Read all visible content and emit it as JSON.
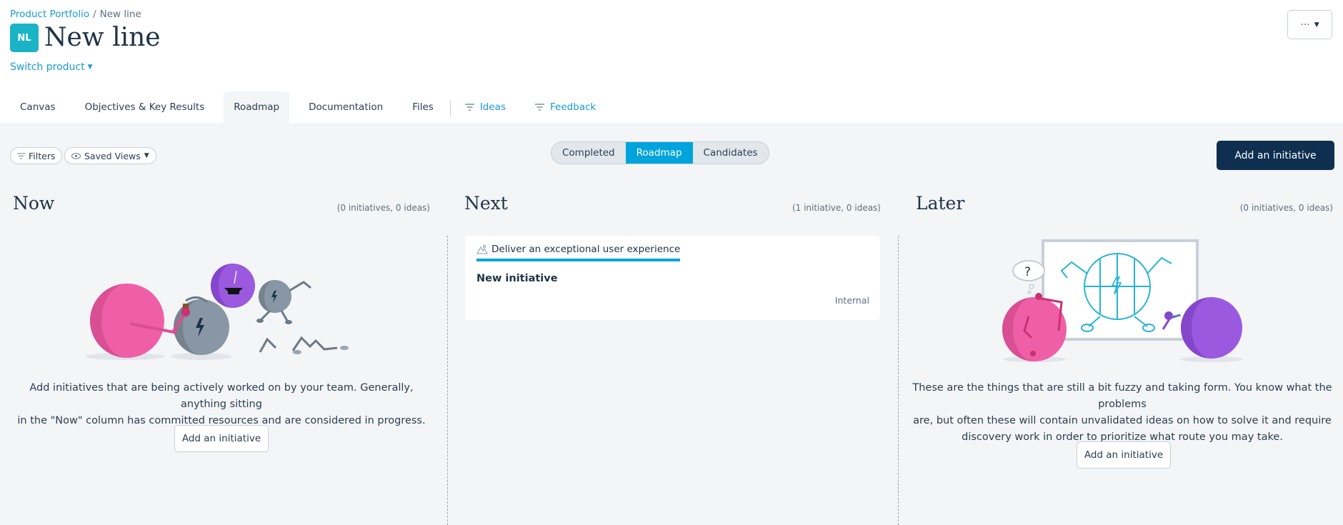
{
  "breadcrumb": {
    "parent": "Product Portfolio",
    "separator": "/",
    "current": "New line"
  },
  "product": {
    "initials": "NL",
    "title": "New line",
    "switch_label": "Switch product",
    "avatar_color": "#1ab4c6"
  },
  "more_menu": {
    "dots": "···"
  },
  "tabs": [
    {
      "label": "Canvas"
    },
    {
      "label": "Objectives & Key Results"
    },
    {
      "label": "Roadmap"
    },
    {
      "label": "Documentation"
    },
    {
      "label": "Files"
    },
    {
      "label": "Ideas"
    },
    {
      "label": "Feedback"
    }
  ],
  "toolbar": {
    "filters_label": "Filters",
    "saved_views_label": "Saved Views",
    "segments": [
      "Completed",
      "Roadmap",
      "Candidates"
    ],
    "active_segment": "Roadmap",
    "add_initiative_label": "Add an initiative"
  },
  "columns": {
    "now": {
      "title": "Now",
      "count": "(0 initiatives, 0 ideas)",
      "description_line1": "Add initiatives that are being actively worked on by your team. Generally, anything sitting",
      "description_line2": "in the \"Now\" column has committed resources and are considered in progress.",
      "button": "Add an initiative"
    },
    "next": {
      "title": "Next",
      "count": "(1 initiative, 0 ideas)",
      "card": {
        "goal": "Deliver an exceptional user experience",
        "title": "New initiative",
        "tag": "Internal"
      }
    },
    "later": {
      "title": "Later",
      "count": "(0 initiatives, 0 ideas)",
      "description_line1": "These are the things that are still a bit fuzzy and taking form. You know what the problems",
      "description_line2": "are, but often these will contain unvalidated ideas on how to solve it and require",
      "description_line3": "discovery work in order to prioritize what route you may take.",
      "button": "Add an initiative"
    }
  },
  "colors": {
    "accent": "#00a4dc",
    "link": "#1b9ad6",
    "primary": "#0e2f4f",
    "pink": "#ef5fa8",
    "purple": "#9b59e0",
    "gray_robot": "#8896a5"
  }
}
